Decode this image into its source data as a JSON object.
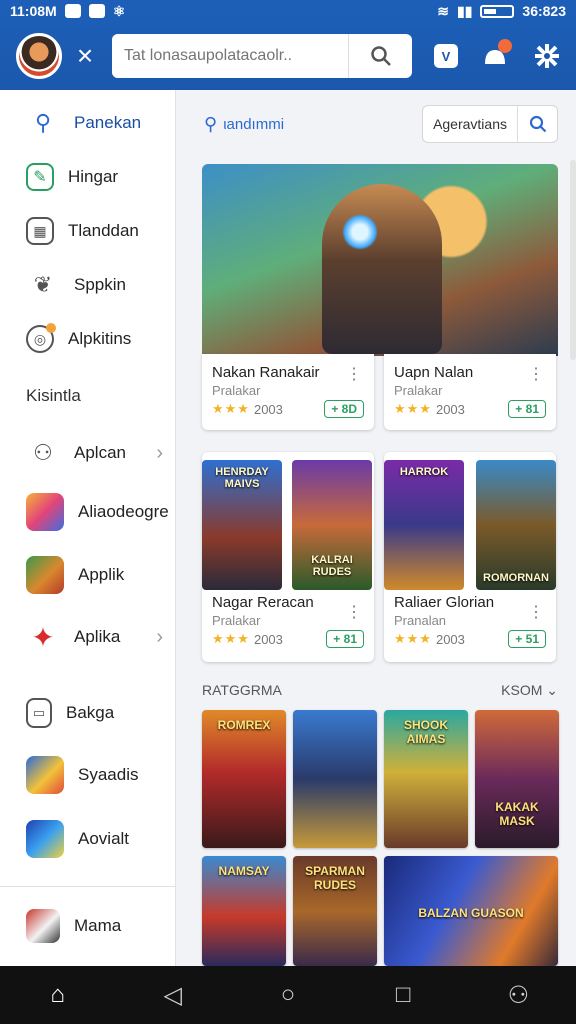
{
  "status_bar": {
    "time": "11:08M",
    "right_text": "36:823"
  },
  "header": {
    "search_placeholder": "Tat lonasaupolatacaolr..",
    "close_glyph": "×",
    "search_glyph": "🔍",
    "icons": [
      "avatar",
      "close-icon",
      "search-icon",
      "shortcut-icon",
      "notification-icon",
      "settings-icon"
    ]
  },
  "sidebar": {
    "items_top": [
      {
        "label": "Panekan",
        "icon": "person-icon",
        "active": true
      },
      {
        "label": "Hingar",
        "icon": "edit-icon"
      },
      {
        "label": "Tlanddan",
        "icon": "calculator-icon"
      },
      {
        "label": "Sppkin",
        "icon": "puzzle-icon"
      },
      {
        "label": "Alpkitins",
        "icon": "badge-icon"
      }
    ],
    "section_heading": "Kisintla",
    "items_bottom": [
      {
        "label": "Aplcan",
        "icon": "user-circle-icon",
        "chevron": true
      },
      {
        "label": "Aliaodeogre",
        "icon": "game-app-icon"
      },
      {
        "label": "Applik",
        "icon": "game-app-icon"
      },
      {
        "label": "Aplika",
        "icon": "game-app-icon",
        "chevron": true
      },
      {
        "label": "Bakga",
        "icon": "clipboard-icon"
      },
      {
        "label": "Syaadis",
        "icon": "game-app-icon"
      },
      {
        "label": "Aovialt",
        "icon": "game-app-icon"
      },
      {
        "label": "Mama",
        "icon": "game-app-icon"
      }
    ]
  },
  "main": {
    "search_link": "ιandımmi",
    "filter_pill": "Ageravtians",
    "cards_row1": [
      {
        "title": "Nakan Ranakair",
        "sub": "Pralakar",
        "stars": "★★★",
        "rating": "2003",
        "btn": "+ 8D"
      },
      {
        "title": "Uapn Nalan",
        "sub": "Pralakar",
        "stars": "★★★",
        "rating": "2003",
        "btn": "+ 81"
      }
    ],
    "cards_row2": [
      {
        "title": "Nagar Reracan",
        "sub": "Pralakar",
        "stars": "★★★",
        "rating": "2003",
        "btn": "+ 81",
        "tiles": [
          "HENRDAY MAIVS",
          "KALRAI RUDES"
        ]
      },
      {
        "title": "Raliaer Glorian",
        "sub": "Pranalan",
        "stars": "★★★",
        "rating": "2003",
        "btn": "+ 51",
        "tiles": [
          "HARROK",
          "ROMORNAN"
        ]
      }
    ],
    "section": {
      "title": "RATGGRMA",
      "more": "KSOM ⌄"
    },
    "grid_tiles": [
      "ROMREX",
      "",
      "SHOOK AIMAS",
      "KAKAK MASK",
      "NAMSAY",
      "SPARMAN RUDES",
      "BALZAN GUASON"
    ]
  },
  "navbar": {
    "home": "⌂",
    "back": "◁",
    "circle": "○",
    "square": "□",
    "profile": "⚇"
  },
  "colors": {
    "header_blue": "#1b58ad",
    "link_blue": "#2d6ad0",
    "accent_green": "#2aa060",
    "star": "#f2b324"
  }
}
